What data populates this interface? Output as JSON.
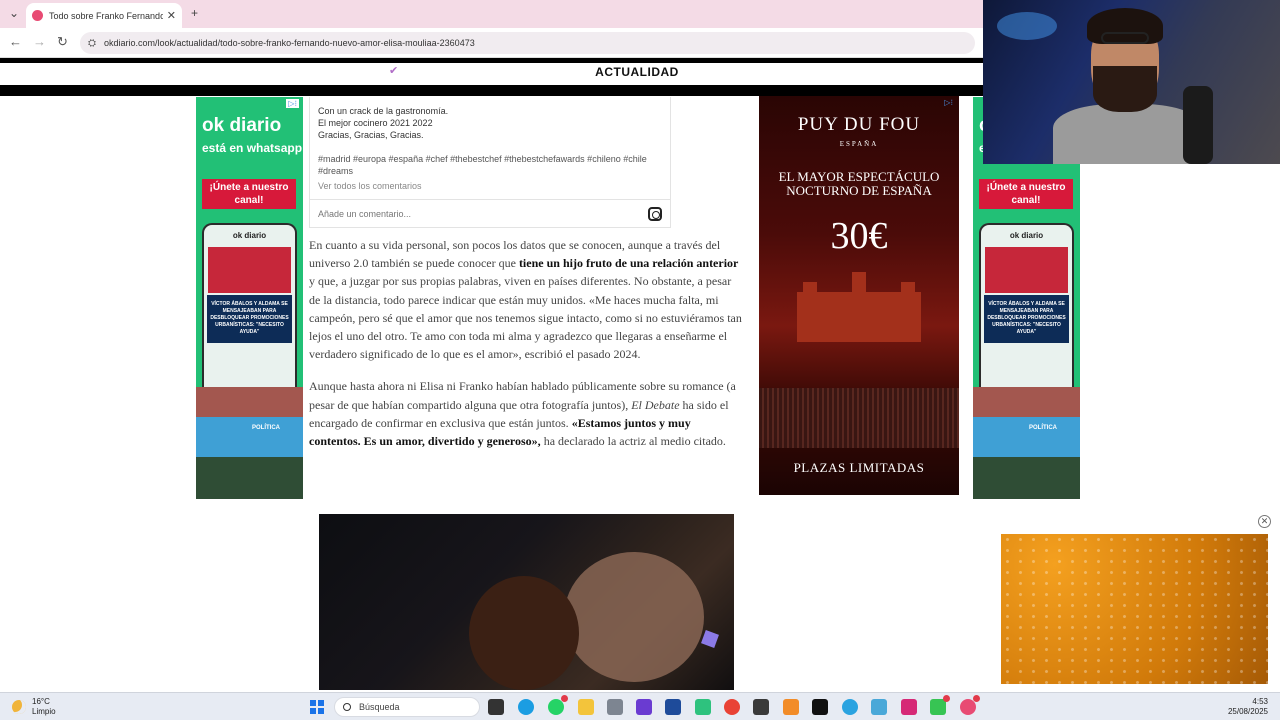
{
  "browser": {
    "tab_title": "Todo sobre Franko Fernando, e",
    "url": "okdiario.com/look/actualidad/todo-sobre-franko-fernando-nuevo-amor-elisa-mouliaa-2360473"
  },
  "site": {
    "section": "ACTUALIDAD"
  },
  "ok_ad": {
    "logo": "ok diario",
    "subtitle": "está en whatsapp",
    "cta": "¡Únete a nuestro canal!",
    "phone_logo": "ok diario",
    "phone_headline": "VÍCTOR ÁBALOS Y ALDAMA SE MENSAJEABAN PARA DESBLOQUEAR PROMOCIONES URBANÍSTICAS: \"NECESITO AYUDA\"",
    "politica": "POLÍTICA"
  },
  "instagram": {
    "caption": [
      "Con un crack de la gastronomía.",
      "El mejor cocinero 2021 2022",
      "Gracias, Gracias, Gracias."
    ],
    "tags": "#madrid #europa #españa #chef #thebestchef #thebestchefawards #chileno #chile #dreams",
    "view_all": "Ver todos los comentarios",
    "comment_placeholder": "Añade un comentario..."
  },
  "article": {
    "p1_a": "En cuanto a su vida personal, son pocos los datos que se conocen, aunque a través del universo 2.0 también se puede conocer que ",
    "p1_b": "tiene un hijo fruto de una relación anterior",
    "p1_c": " y que, a juzgar por sus propias palabras, viven en países diferentes. No obstante, a pesar de la distancia, todo parece indicar que están muy unidos. «Me haces mucha falta, mi campeón, pero sé que el amor que nos tenemos sigue intacto, como si no estuviéramos tan lejos el uno del otro. Te amo con toda mi alma y agradezco que llegaras a enseñarme el verdadero significado de lo que es el amor», escribió el pasado 2024.",
    "p2_a": "Aunque hasta ahora ni Elisa ni Franko habían hablado públicamente sobre su romance (a pesar de que habían compartido alguna que otra fotografía juntos), ",
    "p2_b": "El Debate",
    "p2_c": " ha sido el encargado de confirmar en exclusiva que están juntos. ",
    "p2_d": "«Estamos juntos y muy contentos. Es un amor, divertido y generoso»,",
    "p2_e": " ha declarado la actriz al medio citado."
  },
  "pdf_ad": {
    "brand": "PUY DU FOU",
    "country": "ESPAÑA",
    "headline": "EL MAYOR ESPECTÁCULO NOCTURNO DE ESPAÑA",
    "price": "30€",
    "footer": "PLAZAS LIMITADAS"
  },
  "taskbar": {
    "temp": "16°C",
    "weather": "Limpio",
    "search_placeholder": "Búsqueda",
    "time": "4:53",
    "date": "25/08/2025"
  },
  "colors": {
    "ok_green": "#22c076",
    "ok_red": "#d7193a",
    "tabbar": "#f4dbe6"
  }
}
